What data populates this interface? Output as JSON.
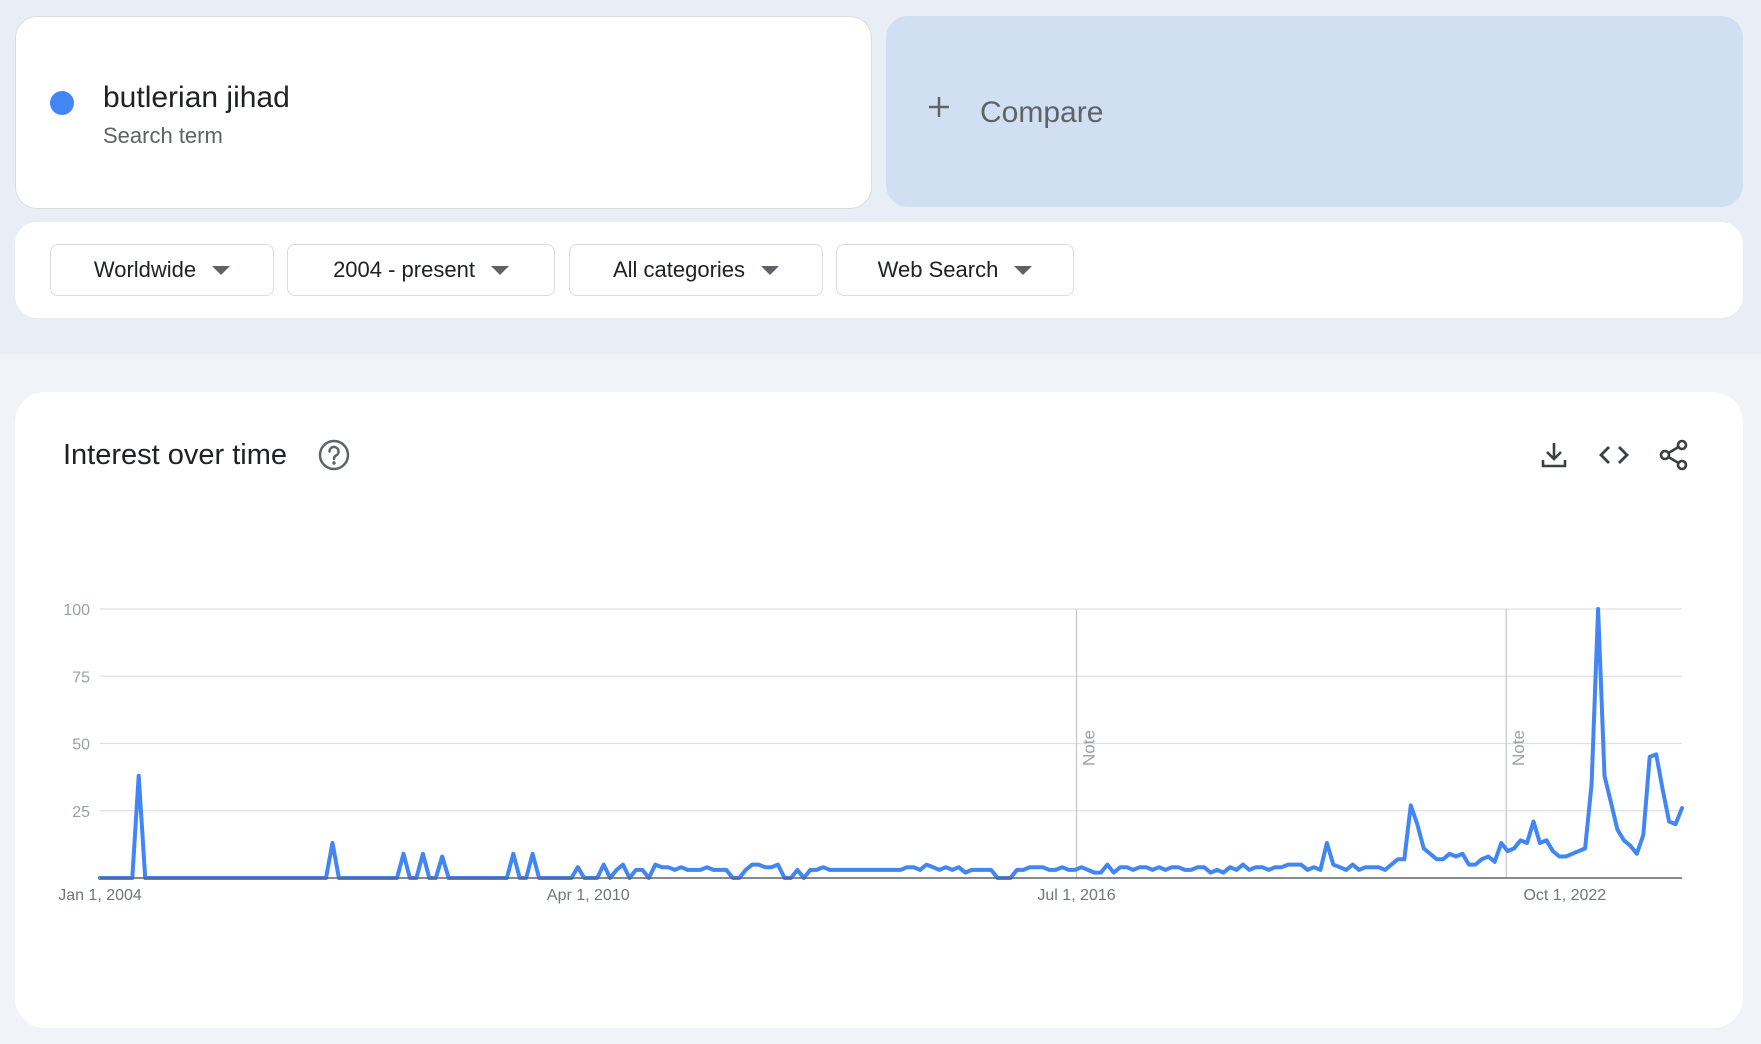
{
  "search_term": {
    "name": "butlerian jihad",
    "subtitle": "Search term",
    "color": "#4285f4"
  },
  "compare": {
    "label": "Compare",
    "icon": "plus-icon"
  },
  "filters": [
    {
      "label": "Worldwide"
    },
    {
      "label": "2004 - present"
    },
    {
      "label": "All categories"
    },
    {
      "label": "Web Search"
    }
  ],
  "panel": {
    "title": "Interest over time",
    "icons": [
      "help-icon",
      "download-icon",
      "embed-icon",
      "share-icon"
    ]
  },
  "chart_data": {
    "type": "line",
    "title": "",
    "xlabel": "",
    "ylabel": "",
    "x_start": "2004-01",
    "x_interval": "month",
    "x_end": "2024-04",
    "x_ticks": [
      "Jan 1, 2004",
      "Apr 1, 2010",
      "Jul 1, 2016",
      "Oct 1, 2022"
    ],
    "y_ticks": [
      "100",
      "75",
      "50",
      "25"
    ],
    "ylim": [
      0,
      100
    ],
    "grid": true,
    "line_color": "#4285f4",
    "notes": [
      {
        "x": "2016-07",
        "label": "Note"
      },
      {
        "x": "2022-01",
        "label": "Note"
      }
    ],
    "series": [
      {
        "values": [
          0,
          0,
          0,
          0,
          0,
          0,
          38,
          0,
          0,
          0,
          0,
          0,
          0,
          0,
          0,
          0,
          0,
          0,
          0,
          0,
          0,
          0,
          0,
          0,
          0,
          0,
          0,
          0,
          0,
          0,
          0,
          0,
          0,
          0,
          0,
          0,
          13,
          0,
          0,
          0,
          0,
          0,
          0,
          0,
          0,
          0,
          0,
          9,
          0,
          0,
          9,
          0,
          0,
          8,
          0,
          0,
          0,
          0,
          0,
          0,
          0,
          0,
          0,
          0,
          9,
          0,
          0,
          9,
          0,
          0,
          0,
          0,
          0,
          0,
          4,
          0,
          0,
          0,
          5,
          0,
          3,
          5,
          0,
          3,
          3,
          0,
          5,
          4,
          4,
          3,
          4,
          3,
          3,
          3,
          4,
          3,
          3,
          3,
          0,
          0,
          3,
          5,
          5,
          4,
          4,
          5,
          0,
          0,
          3,
          0,
          3,
          3,
          4,
          3,
          3,
          3,
          3,
          3,
          3,
          3,
          3,
          3,
          3,
          3,
          3,
          4,
          4,
          3,
          5,
          4,
          3,
          4,
          3,
          4,
          2,
          3,
          3,
          3,
          3,
          0,
          0,
          0,
          3,
          3,
          4,
          4,
          4,
          3,
          3,
          4,
          3,
          3,
          4,
          3,
          2,
          2,
          5,
          2,
          4,
          4,
          3,
          4,
          4,
          3,
          4,
          3,
          4,
          4,
          3,
          3,
          4,
          4,
          2,
          3,
          2,
          4,
          3,
          5,
          3,
          4,
          4,
          3,
          4,
          4,
          5,
          5,
          5,
          3,
          4,
          3,
          13,
          5,
          4,
          3,
          5,
          3,
          4,
          4,
          4,
          3,
          5,
          7,
          7,
          27,
          20,
          11,
          9,
          7,
          7,
          9,
          8,
          9,
          5,
          5,
          7,
          8,
          6,
          13,
          10,
          11,
          14,
          13,
          21,
          13,
          14,
          10,
          8,
          8,
          9,
          10,
          11,
          35,
          100,
          38,
          28,
          18,
          14,
          12,
          9,
          16,
          45,
          46,
          33,
          21,
          20,
          26
        ]
      }
    ]
  }
}
